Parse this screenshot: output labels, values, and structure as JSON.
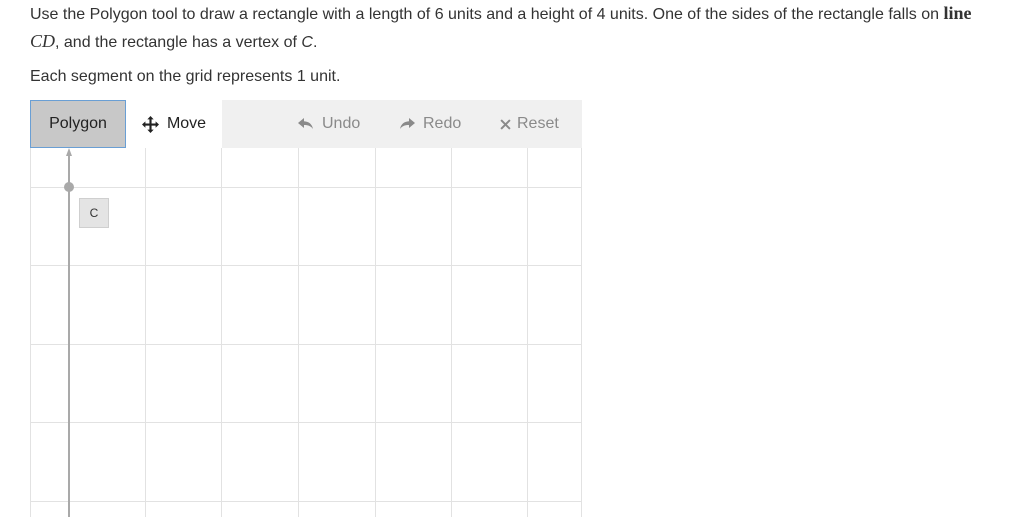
{
  "instructions": {
    "text_before": "Use the Polygon tool to draw a rectangle with a length of 6 units and a height of 4 units. One of the sides of the rectangle falls on ",
    "math_word": "line",
    "math_var": "CD",
    "text_middle": ", and the rectangle has a vertex of ",
    "vertex_var": "C",
    "text_end": "."
  },
  "note": "Each segment on the grid represents 1 unit.",
  "toolbar": {
    "polygon_label": "Polygon",
    "move_label": "Move",
    "move_icon": "move-arrows-icon",
    "undo_label": "Undo",
    "undo_icon": "undo-arrow-icon",
    "redo_label": "Redo",
    "redo_icon": "redo-arrow-icon",
    "reset_label": "Reset",
    "reset_icon": "x-icon",
    "active_tool": "Polygon"
  },
  "graph": {
    "point_label": "C",
    "colors": {
      "grid": "#e2e2e2",
      "line": "#a9a9a9",
      "point": "#a9a9a9",
      "active_tool_bg": "#c8c8c8",
      "active_tool_border": "#6a9fd4"
    }
  }
}
